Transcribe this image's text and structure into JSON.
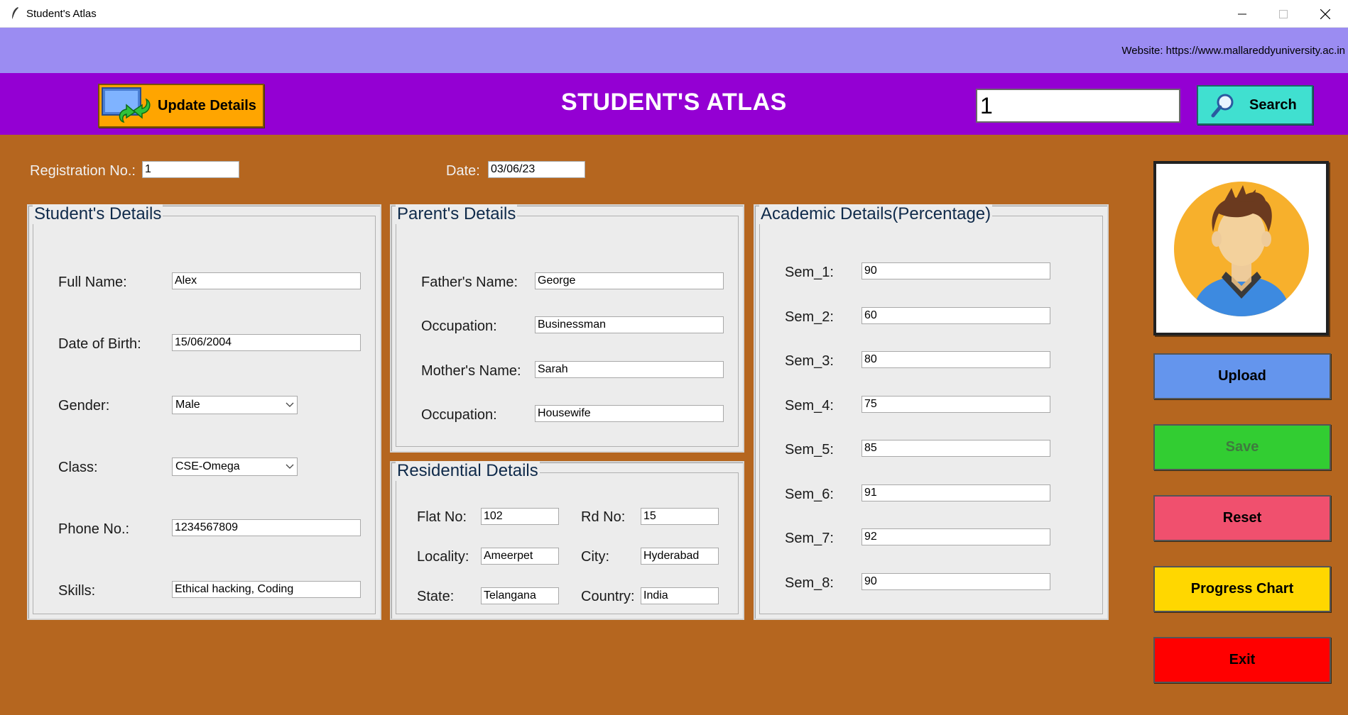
{
  "window": {
    "title": "Student's Atlas"
  },
  "banner": {
    "website": "Website: https://www.mallareddyuniversity.ac.in"
  },
  "header": {
    "update_label": "Update Details",
    "title": "STUDENT'S ATLAS",
    "search_value": "1",
    "search_label": "Search"
  },
  "top": {
    "reg_label": "Registration No.:",
    "reg_value": "1",
    "date_label": "Date:",
    "date_value": "03/06/23"
  },
  "student": {
    "title": "Student's Details",
    "fullname_label": "Full Name:",
    "fullname": "Alex",
    "dob_label": "Date of Birth:",
    "dob": "15/06/2004",
    "gender_label": "Gender:",
    "gender": "Male",
    "class_label": "Class:",
    "class": "CSE-Omega",
    "phone_label": "Phone No.:",
    "phone": "1234567809",
    "skills_label": "Skills:",
    "skills": "Ethical hacking, Coding"
  },
  "parent": {
    "title": "Parent's Details",
    "father_label": "Father's Name:",
    "father": "George",
    "focc_label": "Occupation:",
    "focc": "Businessman",
    "mother_label": "Mother's Name:",
    "mother": "Sarah",
    "mocc_label": "Occupation:",
    "mocc": "Housewife"
  },
  "residential": {
    "title": "Residential Details",
    "flat_label": "Flat No:",
    "flat": "102",
    "rd_label": "Rd No:",
    "rd": "15",
    "locality_label": "Locality:",
    "locality": "Ameerpet",
    "city_label": "City:",
    "city": "Hyderabad",
    "state_label": "State:",
    "state": "Telangana",
    "country_label": "Country:",
    "country": "India"
  },
  "academic": {
    "title": "Academic Details(Percentage)",
    "sems": [
      {
        "label": "Sem_1:",
        "value": "90"
      },
      {
        "label": "Sem_2:",
        "value": "60"
      },
      {
        "label": "Sem_3:",
        "value": "80"
      },
      {
        "label": "Sem_4:",
        "value": "75"
      },
      {
        "label": "Sem_5:",
        "value": "85"
      },
      {
        "label": "Sem_6:",
        "value": "91"
      },
      {
        "label": "Sem_7:",
        "value": "92"
      },
      {
        "label": "Sem_8:",
        "value": "90"
      }
    ]
  },
  "actions": {
    "upload": "Upload",
    "save": "Save",
    "reset": "Reset",
    "progress": "Progress Chart",
    "exit": "Exit"
  },
  "colors": {
    "background": "#b5661f",
    "banner": "#9b8cf2",
    "header": "#9400d3",
    "update": "#ffa500",
    "search": "#40e0d0",
    "upload": "#6495ed",
    "save": "#32cd32",
    "reset": "#f0506e",
    "progress": "#ffd700",
    "exit": "#ff0000"
  }
}
